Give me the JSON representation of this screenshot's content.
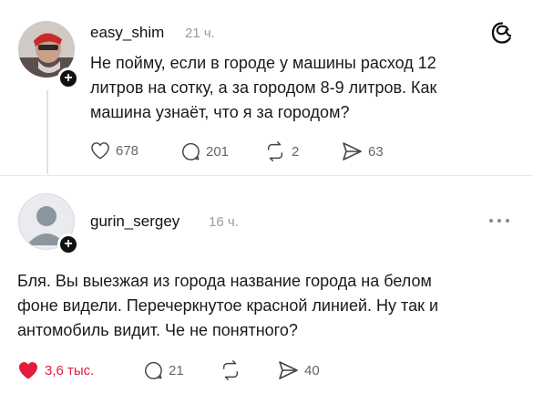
{
  "posts": [
    {
      "username": "easy_shim",
      "time": "21 ч.",
      "text": "Не пойму, если в городе у машины расход 12 литров на сотку, а за городом 8-9 литров. Как машина узнаёт, что я за городом?",
      "lines": [
        "Не пойму, если в городе у машины расход 12",
        "литров на сотку, а за городом 8-9 литров. Как",
        "машина узнаёт, что я за городом?"
      ],
      "likes": "678",
      "comments": "201",
      "reposts": "2",
      "shares": "63",
      "liked": false
    },
    {
      "username": "gurin_sergey",
      "time": "16 ч.",
      "lines": [
        "Бля. Вы выезжая из города название города на белом",
        "фоне видели. Перечеркнутое красной линией. Ну так и",
        "антомобиль видит. Че не понятного?"
      ],
      "likes": "3,6 тыс.",
      "comments": "21",
      "reposts": "",
      "shares": "40",
      "liked": true
    }
  ],
  "colors": {
    "like_active": "#e01e3c",
    "muted": "#9a9a9a",
    "text": "#111111"
  },
  "icons": [
    "threads-logo-icon",
    "plus-icon",
    "heart-icon",
    "comment-icon",
    "repost-icon",
    "share-icon",
    "more-icon"
  ]
}
